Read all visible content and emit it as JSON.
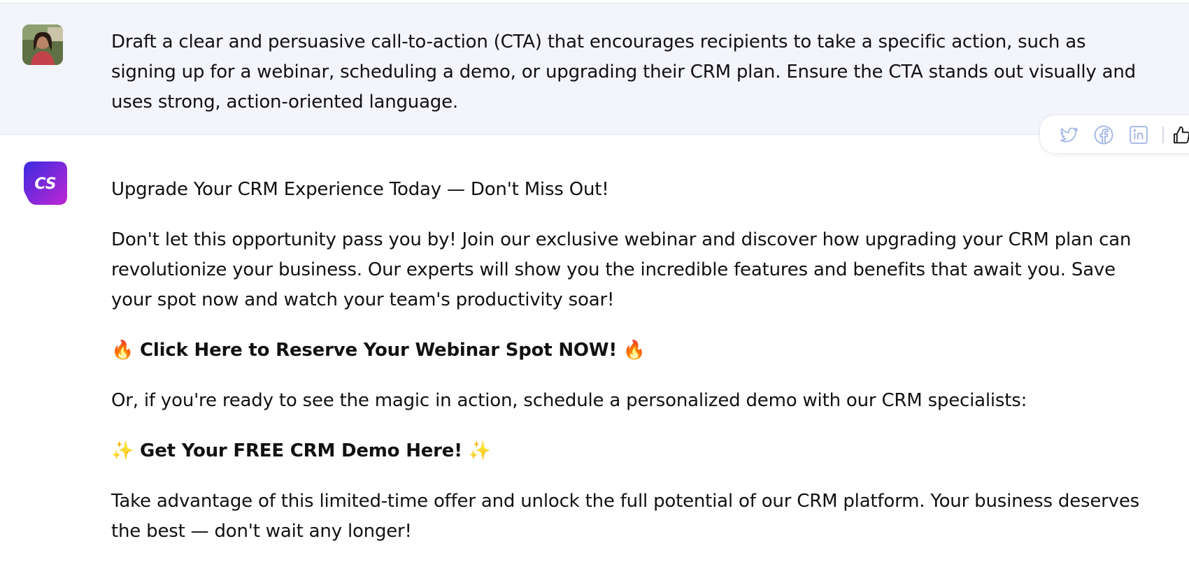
{
  "user_message": {
    "avatar": "user-photo-avatar",
    "text": "Draft a clear and persuasive call-to-action (CTA) that encourages recipients to take a specific action, such as signing up for a webinar, scheduling a demo, or upgrading their CRM plan. Ensure the CTA stands out visually and uses strong, action-oriented language."
  },
  "share_bar": {
    "icons": [
      "twitter-icon",
      "facebook-icon",
      "linkedin-icon",
      "thumbs-up-icon"
    ],
    "color": "#9db1e6"
  },
  "assistant": {
    "avatar_label": "CS",
    "avatar_gradient": [
      "#3b2be0",
      "#c026d3"
    ],
    "heading": "Upgrade Your CRM Experience Today — Don't Miss Out!",
    "paragraph_1": "Don't let this opportunity pass you by! Join our exclusive webinar and discover how upgrading your CRM plan can revolutionize your business. Our experts will show you the incredible features and benefits that await you. Save your spot now and watch your team's productivity soar!",
    "cta_1": {
      "emoji": "🔥",
      "text": "Click Here to Reserve Your Webinar Spot NOW!"
    },
    "paragraph_2": "Or, if you're ready to see the magic in action, schedule a personalized demo with our CRM specialists:",
    "cta_2": {
      "emoji": "✨",
      "text": "Get Your FREE CRM Demo Here!"
    },
    "paragraph_3": "Take advantage of this limited-time offer and unlock the full potential of our CRM platform. Your business deserves the best — don't wait any longer!"
  }
}
